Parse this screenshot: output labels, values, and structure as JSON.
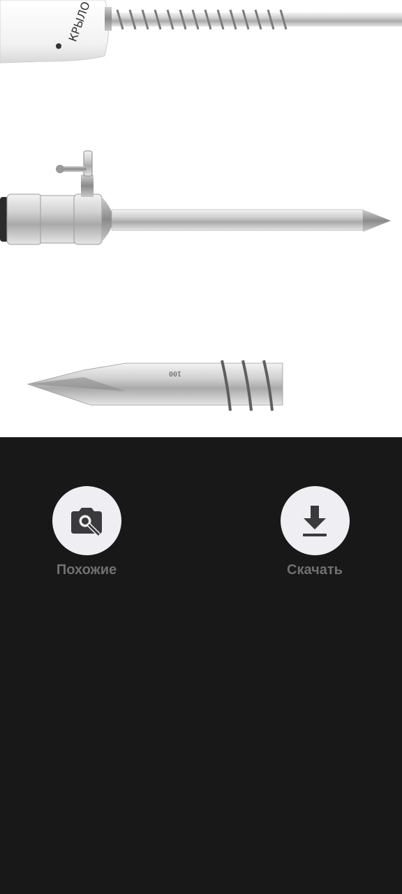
{
  "image": {
    "brand_text": "КРЫЛО",
    "mark_small": "100"
  },
  "actions": {
    "similar": {
      "label": "Похожие",
      "icon": "camera-search-icon"
    },
    "download": {
      "label": "Скачать",
      "icon": "download-icon"
    }
  },
  "colors": {
    "image_background": "#ffffff",
    "panel_background": "#181818",
    "button_circle": "#efeff3",
    "icon": "#3a3a3c",
    "label": "#707070"
  }
}
